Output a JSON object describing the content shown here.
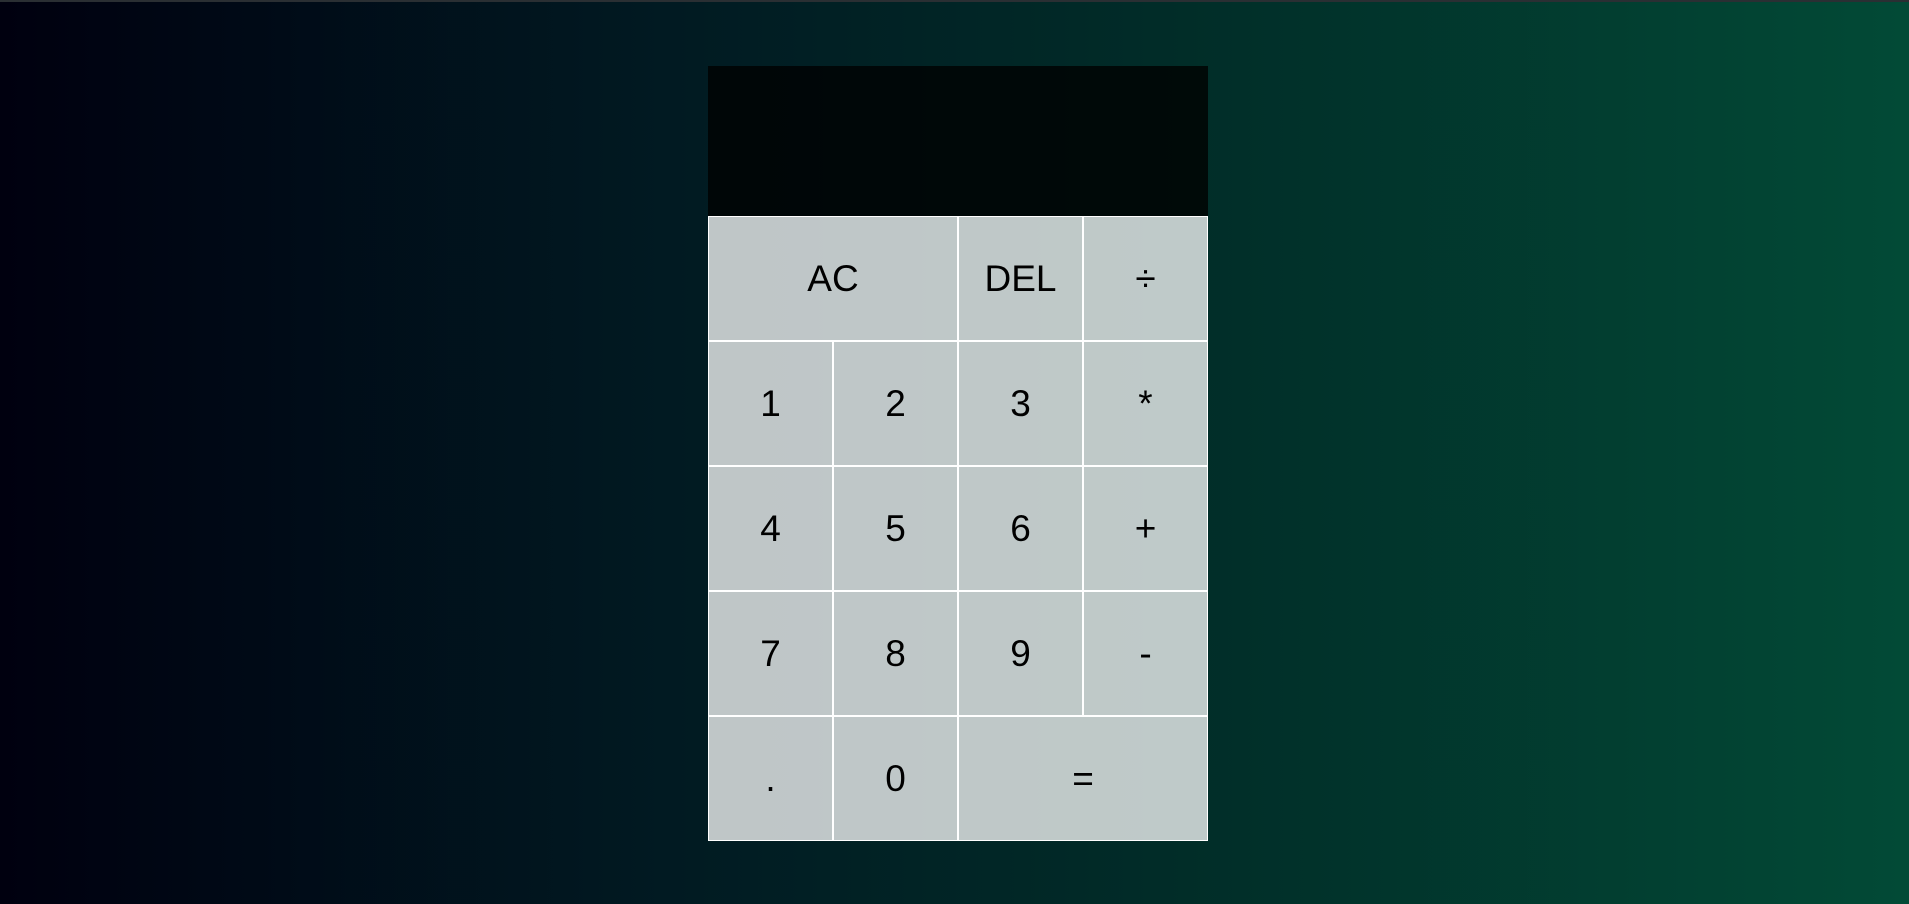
{
  "display": {
    "previous_operand": "",
    "current_operand": ""
  },
  "keys": {
    "ac": "AC",
    "del": "DEL",
    "divide": "÷",
    "one": "1",
    "two": "2",
    "three": "3",
    "multiply": "*",
    "four": "4",
    "five": "5",
    "six": "6",
    "add": "+",
    "seven": "7",
    "eight": "8",
    "nine": "9",
    "subtract": "-",
    "decimal": ".",
    "zero": "0",
    "equals": "="
  },
  "colors": {
    "background_start": "#00000f",
    "background_end": "#024a36",
    "display_background": "#020807",
    "key_background": "#c0c7c8",
    "key_border": "#ffffff",
    "key_text": "#000000"
  }
}
